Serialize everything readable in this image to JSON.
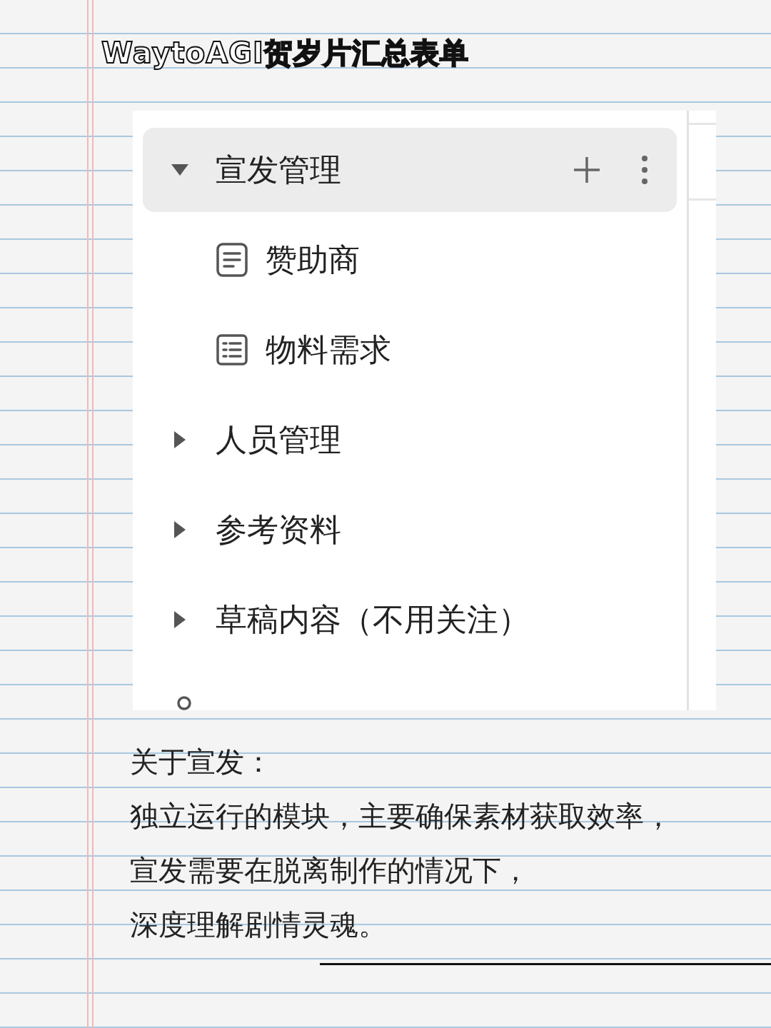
{
  "title": "WaytoAGI贺岁片汇总表单",
  "tree": [
    {
      "label": "宣发管理",
      "kind": "folder",
      "expanded": true,
      "selected": true,
      "children": [
        {
          "label": "赞助商",
          "kind": "doc",
          "selected": false
        },
        {
          "label": "物料需求",
          "kind": "table",
          "selected": false
        }
      ]
    },
    {
      "label": "人员管理",
      "kind": "folder",
      "expanded": false,
      "selected": false
    },
    {
      "label": "参考资料",
      "kind": "folder",
      "expanded": false,
      "selected": false
    },
    {
      "label": "草稿内容（不用关注）",
      "kind": "folder",
      "expanded": false,
      "selected": false
    },
    {
      "kind": "workflow",
      "selected": false
    }
  ],
  "caption": {
    "heading": "关于宣发：",
    "lines": [
      "独立运行的模块，主要确保素材获取效率，",
      "宣发需要在脱离制作的情况下，",
      "深度理解剧情灵魂。"
    ]
  }
}
